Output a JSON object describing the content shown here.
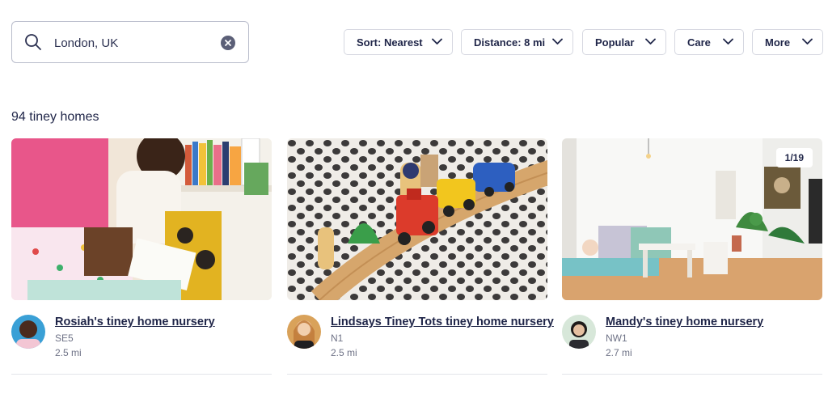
{
  "search": {
    "value": "London, UK",
    "search_icon": "search-icon",
    "clear_icon": "close-circle-icon"
  },
  "filters": [
    {
      "label": "Sort: Nearest"
    },
    {
      "label": "Distance: 8 mi"
    },
    {
      "label": "Popular"
    },
    {
      "label": "Care"
    },
    {
      "label": "More"
    }
  ],
  "results": {
    "count_text": "94 tiney homes"
  },
  "listings": [
    {
      "name": "Rosiah's tiney home nursery",
      "postcode": "SE5",
      "distance": "2.5 mi"
    },
    {
      "name": "Lindsays Tiney Tots tiney home nursery",
      "postcode": "N1",
      "distance": "2.5 mi"
    },
    {
      "name": "Mandy's tiney home nursery",
      "postcode": "NW1",
      "distance": "2.7 mi",
      "photo_counter": "1/19"
    }
  ],
  "colors": {
    "text_primary": "#1f2548",
    "text_secondary": "#6e7286",
    "border": "#d6d8e1"
  }
}
